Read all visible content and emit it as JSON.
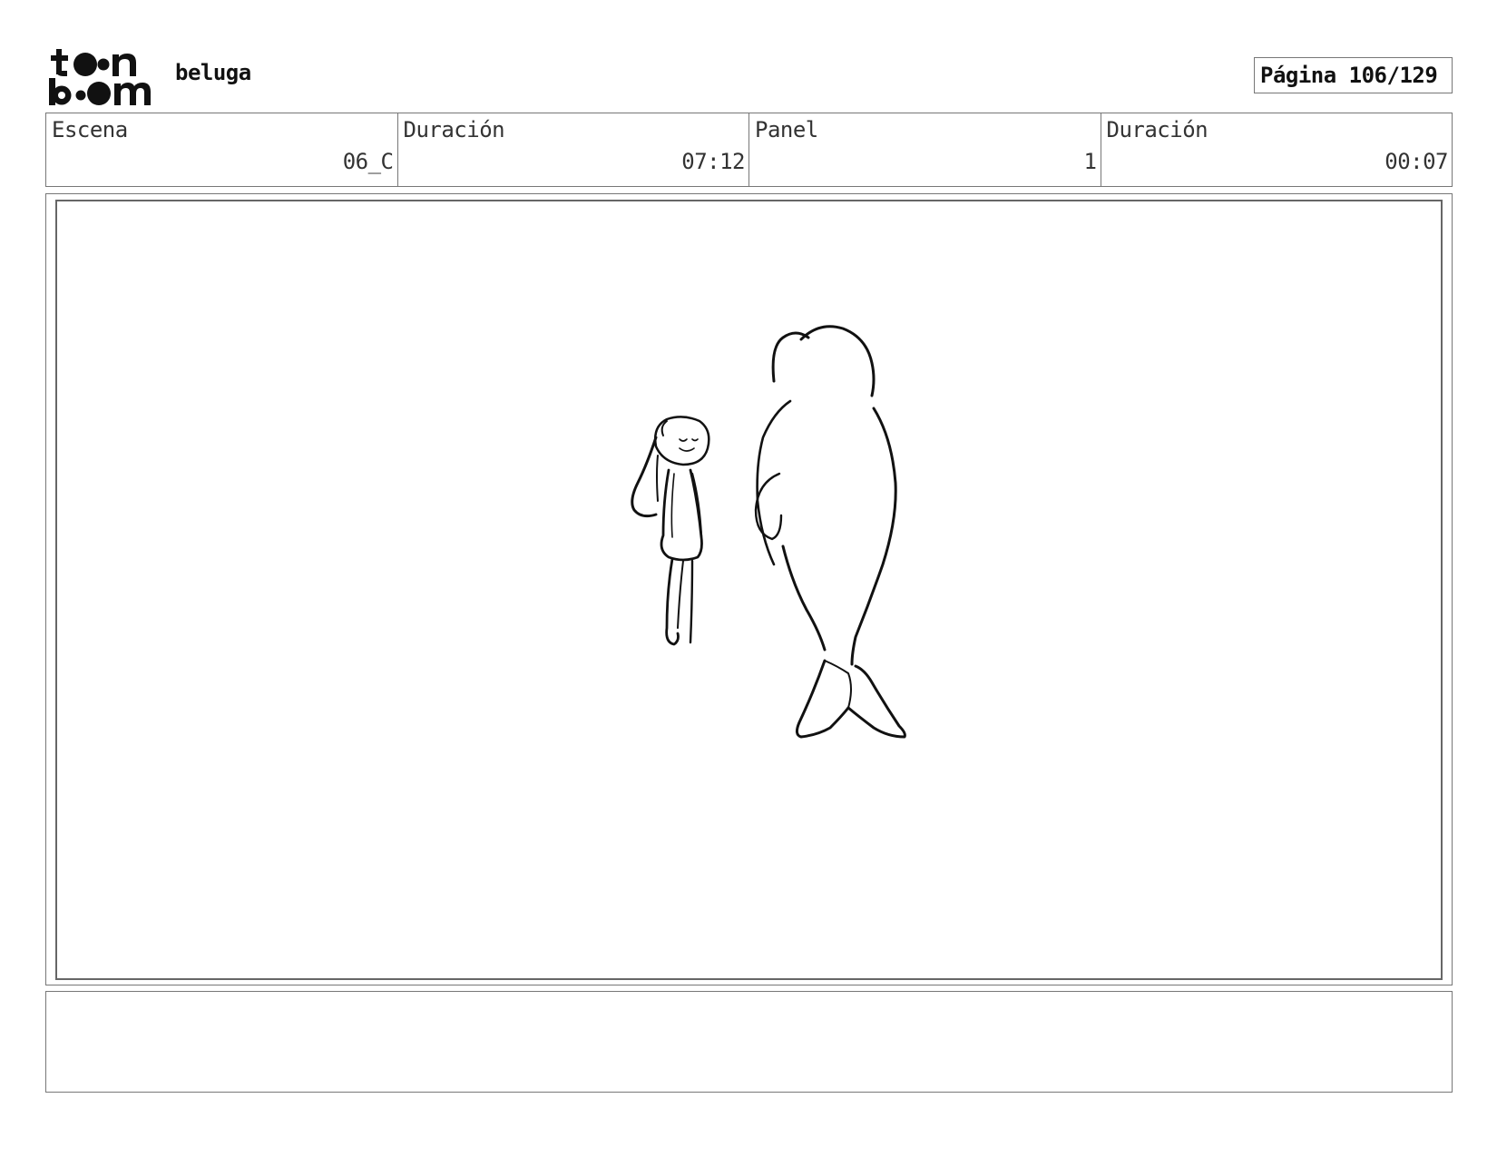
{
  "header": {
    "logo_top": "t●●n",
    "logo_bottom": "b●●m",
    "project_title": "beluga",
    "page_label": "Página 106/129"
  },
  "info": {
    "scene_label": "Escena",
    "scene_value": "06_C",
    "scene_duration_label": "Duración",
    "scene_duration_value": "07:12",
    "panel_label": "Panel",
    "panel_value": "1",
    "panel_duration_label": "Duración",
    "panel_duration_value": "00:07"
  },
  "panel": {
    "sketch": "girl-and-beluga-sketch-icon"
  },
  "notes": {
    "text": ""
  },
  "colors": {
    "border": "#777777",
    "ink": "#111111"
  }
}
